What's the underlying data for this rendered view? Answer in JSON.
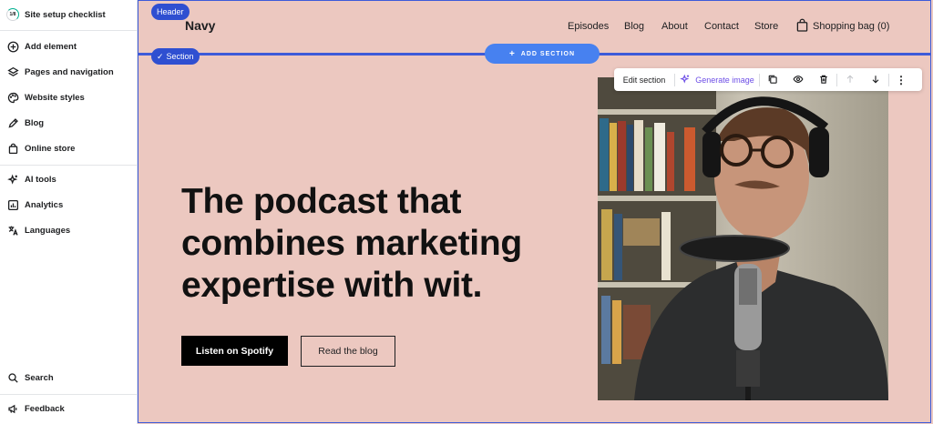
{
  "sidebar": {
    "checklist": {
      "label": "Site setup checklist",
      "progress": "1/8"
    },
    "items": [
      {
        "label": "Add element",
        "icon": "plus-circle-icon"
      },
      {
        "label": "Pages and navigation",
        "icon": "layers-icon"
      },
      {
        "label": "Website styles",
        "icon": "palette-icon"
      },
      {
        "label": "Blog",
        "icon": "pen-icon"
      },
      {
        "label": "Online store",
        "icon": "bag-icon"
      },
      {
        "label": "AI tools",
        "icon": "sparkle-icon"
      },
      {
        "label": "Analytics",
        "icon": "chart-icon"
      },
      {
        "label": "Languages",
        "icon": "translate-icon"
      }
    ],
    "search": "Search",
    "feedback": "Feedback"
  },
  "canvas": {
    "header_pill": "Header",
    "section_pill": "Section",
    "brand": "Navy",
    "nav": [
      "Episodes",
      "Blog",
      "About",
      "Contact",
      "Store"
    ],
    "bag": "Shopping bag (0)",
    "add_section": "ADD SECTION",
    "toolbar": {
      "edit": "Edit section",
      "generate": "Generate image"
    },
    "hero": {
      "title": "The podcast that combines marketing expertise with wit.",
      "primary_button": "Listen on Spotify",
      "secondary_button": "Read the blog"
    }
  },
  "colors": {
    "accent": "#2f4fd1",
    "add_section": "#4781f0",
    "background": "#ecc8c0",
    "generate": "#6d4ee6"
  }
}
